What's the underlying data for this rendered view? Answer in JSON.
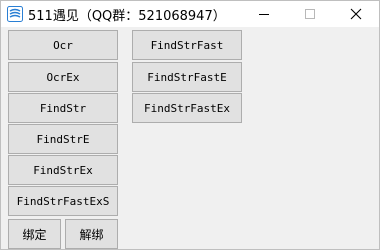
{
  "window": {
    "title": "511遇见（QQ群：521068947）"
  },
  "buttons": {
    "ocr": "Ocr",
    "ocr_ex": "OcrEx",
    "find_str": "FindStr",
    "find_str_e": "FindStrE",
    "find_str_ex": "FindStrEx",
    "find_str_fast_ex_s": "FindStrFastExS",
    "bind": "绑定",
    "unbind": "解绑",
    "find_str_fast": "FindStrFast",
    "find_str_fast_e": "FindStrFastE",
    "find_str_fast_ex": "FindStrFastEx"
  }
}
